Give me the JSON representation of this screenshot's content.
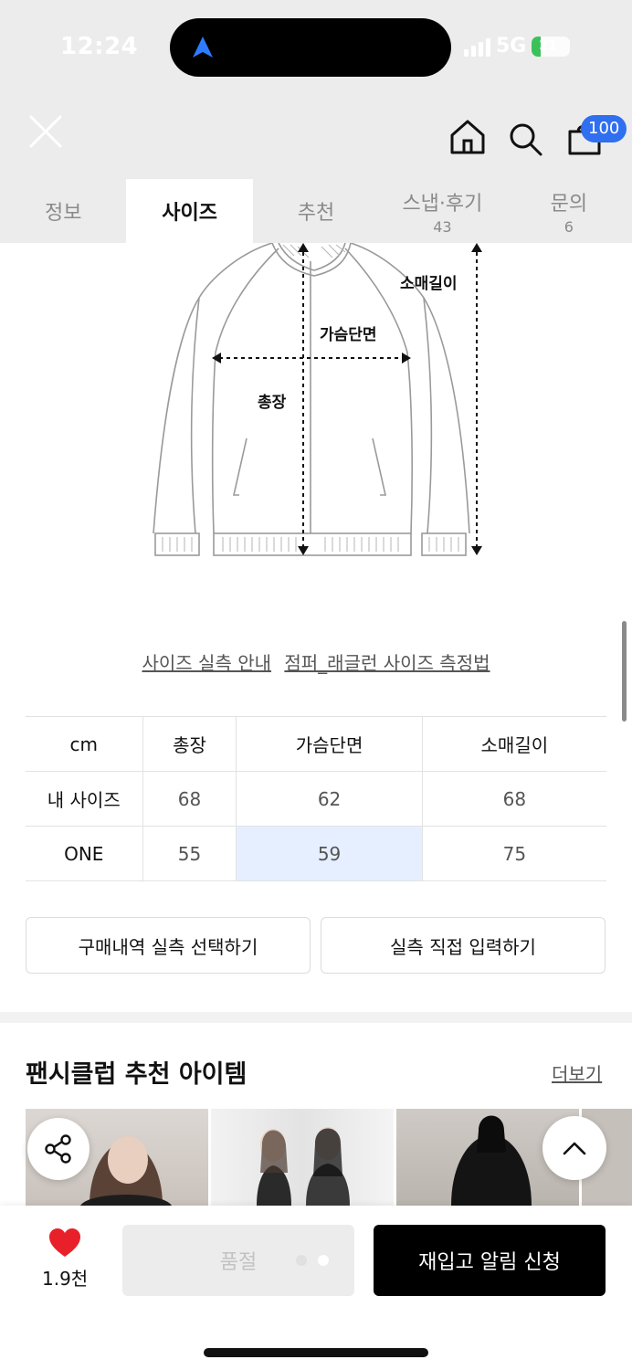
{
  "status_bar": {
    "time": "12:24",
    "network": "5G",
    "battery": "21"
  },
  "header": {
    "cart_count": "100"
  },
  "tabs": [
    {
      "label": "정보",
      "count": ""
    },
    {
      "label": "사이즈",
      "count": "",
      "active": true
    },
    {
      "label": "추천",
      "count": ""
    },
    {
      "label": "스냅·후기",
      "count": "43"
    },
    {
      "label": "문의",
      "count": "6"
    }
  ],
  "diagram": {
    "sleeve_label": "소매길이",
    "chest_label": "가슴단면",
    "length_label": "총장"
  },
  "links": {
    "guide": "사이즈 실측 안내",
    "method": "점퍼_래글런 사이즈 측정법"
  },
  "size_table": {
    "headers": [
      "cm",
      "총장",
      "가슴단면",
      "소매길이"
    ],
    "rows": [
      {
        "label": "내 사이즈",
        "values": [
          "68",
          "62",
          "68"
        ]
      },
      {
        "label": "ONE",
        "values": [
          "55",
          "59",
          "75"
        ]
      }
    ]
  },
  "buttons": {
    "select_purchase": "구매내역 실측 선택하기",
    "manual_input": "실측 직접 입력하기"
  },
  "recommend": {
    "title": "팬시클럽 추천 아이템",
    "more": "더보기"
  },
  "bottom": {
    "likes": "1.9천",
    "soldout": "품절",
    "restock": "재입고 알림 신청"
  },
  "colors": {
    "accent": "#2f6ff0",
    "highlight": "#e6efff",
    "heart": "#e8202a"
  }
}
